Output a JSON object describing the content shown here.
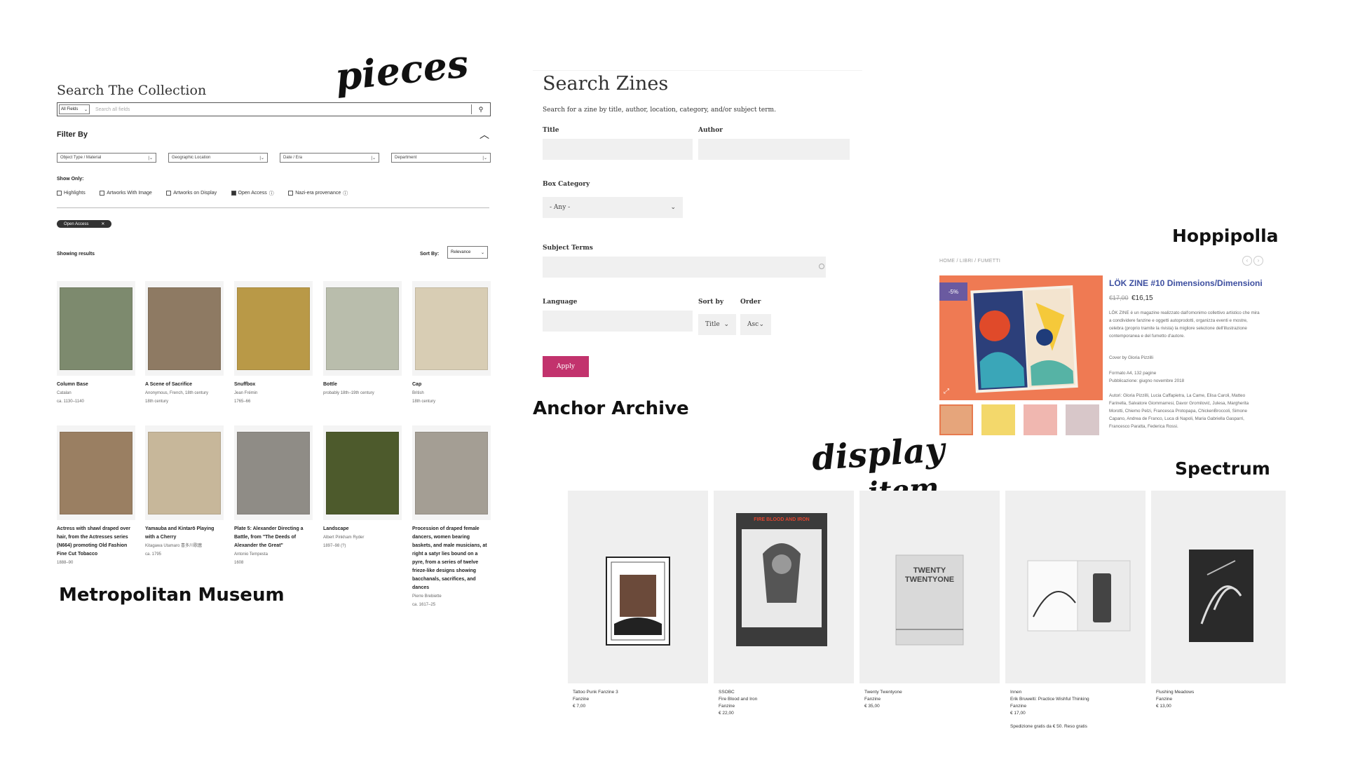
{
  "labels": {
    "met": "Metropolitan Museum",
    "anchor": "Anchor Archive",
    "hoppipolla": "Hoppipolla",
    "spectrum": "Spectrum",
    "script_pieces": "pieces",
    "script_display": "display",
    "script_item": "item"
  },
  "met": {
    "title": "Search The Collection",
    "search": {
      "field_select": "All Fields",
      "placeholder": "Search all fields"
    },
    "filter_by": "Filter By",
    "filters": [
      "Object Type / Material",
      "Geographic Location",
      "Date / Era",
      "Department"
    ],
    "show_only_label": "Show Only:",
    "show_only": [
      {
        "label": "Highlights",
        "checked": false
      },
      {
        "label": "Artworks With Image",
        "checked": false
      },
      {
        "label": "Artworks on Display",
        "checked": false
      },
      {
        "label": "Open Access",
        "checked": true
      },
      {
        "label": "Nazi-era provenance",
        "checked": false
      }
    ],
    "active_chip": "Open Access",
    "showing": "Showing results",
    "sort_label": "Sort By:",
    "sort_value": "Relevance",
    "cards": [
      {
        "title": "Column Base",
        "lines": [
          "Catalan",
          "ca. 1130–1140"
        ],
        "color": "#7d8a6e"
      },
      {
        "title": "A Scene of Sacrifice",
        "lines": [
          "Anonymous, French, 18th century",
          "18th century"
        ],
        "color": "#8e7a63"
      },
      {
        "title": "Snuffbox",
        "lines": [
          "Jean Frémin",
          "1765–66"
        ],
        "color": "#b99947"
      },
      {
        "title": "Bottle",
        "lines": [
          "probably 18th–19th century"
        ],
        "color": "#b9bdac"
      },
      {
        "title": "Cap",
        "lines": [
          "British",
          "18th century"
        ],
        "color": "#d8cdb4"
      },
      {
        "title": "Actress with shawl draped over hair, from the Actresses series (N664) promoting Old Fashion Fine Cut Tobacco",
        "lines": [
          "1888–90"
        ],
        "color": "#9a7f62"
      },
      {
        "title": "Yamauba and Kintarō Playing with a Cherry",
        "lines": [
          "Kitagawa Utamaro 喜多川歌麿",
          "ca. 1795"
        ],
        "color": "#c7b79a"
      },
      {
        "title": "Plate 5: Alexander Directing a Battle, from \"The Deeds of Alexander the Great\"",
        "lines": [
          "Antonio Tempesta",
          "1608"
        ],
        "color": "#8f8c86"
      },
      {
        "title": "Landscape",
        "lines": [
          "Albert Pinkham Ryder",
          "1897–98 (?)"
        ],
        "color": "#4d5a2c"
      },
      {
        "title": "Procession of draped female dancers, women bearing baskets, and male musicians, at right a satyr lies bound on a pyre, from a series of twelve frieze-like designs showing bacchanals, sacrifices, and dances",
        "lines": [
          "Pierre Brebiette",
          "ca. 1617–25"
        ],
        "color": "#a49e94"
      }
    ]
  },
  "anchor": {
    "title": "Search Zines",
    "subtitle": "Search for a zine by title, author, location, category, and/or subject term.",
    "title_label": "Title",
    "author_label": "Author",
    "box_label": "Box Category",
    "box_value": "- Any -",
    "subject_label": "Subject Terms",
    "language_label": "Language",
    "sortby_label": "Sort by",
    "sortby_value": "Title",
    "order_label": "Order",
    "order_value": "Asc",
    "apply": "Apply"
  },
  "hoppipolla": {
    "breadcrumb": "HOME  /  LIBRI  /  FUMETTI",
    "badge": "-5%",
    "title": "LÖK ZINE #10 Dimensions/Dimensioni",
    "old_price": "€17,00",
    "price": "€16,15",
    "desc": "LÖK ZINE è un magazine realizzato dall'omonimo collettivo artistico che mira a condividere fanzine e oggetti autoprodotti, organizza eventi e mostre, celebra (proprio tramite la rivista) la migliore selezione dell'illustrazione contemporanea e del fumetto d'autore.",
    "cover": "Cover by Gloria Pizzilli",
    "format": "Formato A4, 132 pagine",
    "publication": "Pubblicazione: giugno novembre 2018",
    "authors": "Autori: Gloria Pizzilli, Lucia Caffapietra, La Came, Elisa Caroli, Matteo Farinella, Salvatore Giommarresi, Davor Gromilović, Julesa, Margherita Morotti, Chiemo Pelzi, Francesca Protopapa, ChickenBroccoli, Simone Capano, Andrea de Franco, Luca di Napoli, Maria Gabriella Gasparri, Francesco Paratta, Federica Rossi."
  },
  "spectrum": {
    "items": [
      {
        "lines": [
          "Tattoo Punk Fanzine 3",
          "Fanzine",
          "€ 7,00"
        ]
      },
      {
        "lines": [
          "SSOBC",
          "Fire Blood and Iron",
          "Fanzine",
          "€ 22,00"
        ]
      },
      {
        "lines": [
          "Twenty Twentyone",
          "Fanzine",
          "€ 35,00"
        ]
      },
      {
        "lines": [
          "Innen",
          "Erik Bruwelti: Practice Wishful Thinking",
          "Fanzine",
          "€ 17,00"
        ]
      },
      {
        "lines": [
          "Flushing Meadows",
          "Fanzine",
          "€ 13,00"
        ]
      }
    ],
    "cover_texts": {
      "item2": "FIRE BLOOD AND IRON",
      "item3": "TWENTY TWENTYONE"
    },
    "shipping": "Spedizione gratis da € 50. Reso gratis"
  }
}
